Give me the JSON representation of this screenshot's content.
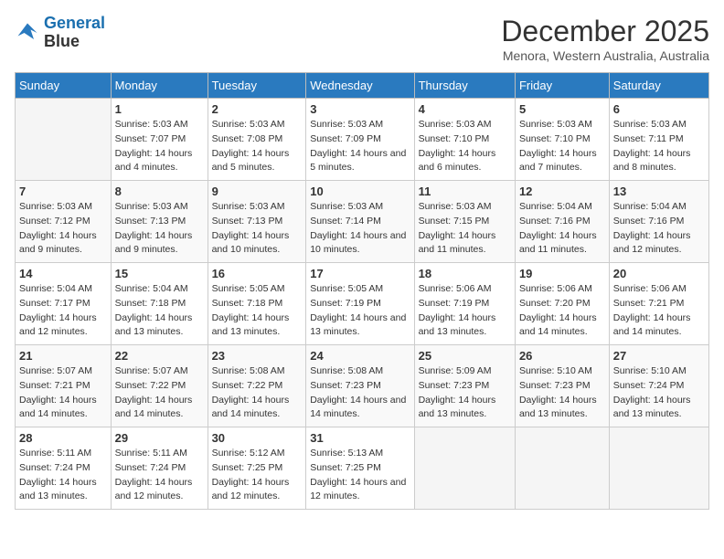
{
  "header": {
    "logo_line1": "General",
    "logo_line2": "Blue",
    "month_title": "December 2025",
    "location": "Menora, Western Australia, Australia"
  },
  "days_of_week": [
    "Sunday",
    "Monday",
    "Tuesday",
    "Wednesday",
    "Thursday",
    "Friday",
    "Saturday"
  ],
  "weeks": [
    [
      {
        "day": "",
        "sunrise": "",
        "sunset": "",
        "daylight": ""
      },
      {
        "day": "1",
        "sunrise": "Sunrise: 5:03 AM",
        "sunset": "Sunset: 7:07 PM",
        "daylight": "Daylight: 14 hours and 4 minutes."
      },
      {
        "day": "2",
        "sunrise": "Sunrise: 5:03 AM",
        "sunset": "Sunset: 7:08 PM",
        "daylight": "Daylight: 14 hours and 5 minutes."
      },
      {
        "day": "3",
        "sunrise": "Sunrise: 5:03 AM",
        "sunset": "Sunset: 7:09 PM",
        "daylight": "Daylight: 14 hours and 5 minutes."
      },
      {
        "day": "4",
        "sunrise": "Sunrise: 5:03 AM",
        "sunset": "Sunset: 7:10 PM",
        "daylight": "Daylight: 14 hours and 6 minutes."
      },
      {
        "day": "5",
        "sunrise": "Sunrise: 5:03 AM",
        "sunset": "Sunset: 7:10 PM",
        "daylight": "Daylight: 14 hours and 7 minutes."
      },
      {
        "day": "6",
        "sunrise": "Sunrise: 5:03 AM",
        "sunset": "Sunset: 7:11 PM",
        "daylight": "Daylight: 14 hours and 8 minutes."
      }
    ],
    [
      {
        "day": "7",
        "sunrise": "Sunrise: 5:03 AM",
        "sunset": "Sunset: 7:12 PM",
        "daylight": "Daylight: 14 hours and 9 minutes."
      },
      {
        "day": "8",
        "sunrise": "Sunrise: 5:03 AM",
        "sunset": "Sunset: 7:13 PM",
        "daylight": "Daylight: 14 hours and 9 minutes."
      },
      {
        "day": "9",
        "sunrise": "Sunrise: 5:03 AM",
        "sunset": "Sunset: 7:13 PM",
        "daylight": "Daylight: 14 hours and 10 minutes."
      },
      {
        "day": "10",
        "sunrise": "Sunrise: 5:03 AM",
        "sunset": "Sunset: 7:14 PM",
        "daylight": "Daylight: 14 hours and 10 minutes."
      },
      {
        "day": "11",
        "sunrise": "Sunrise: 5:03 AM",
        "sunset": "Sunset: 7:15 PM",
        "daylight": "Daylight: 14 hours and 11 minutes."
      },
      {
        "day": "12",
        "sunrise": "Sunrise: 5:04 AM",
        "sunset": "Sunset: 7:16 PM",
        "daylight": "Daylight: 14 hours and 11 minutes."
      },
      {
        "day": "13",
        "sunrise": "Sunrise: 5:04 AM",
        "sunset": "Sunset: 7:16 PM",
        "daylight": "Daylight: 14 hours and 12 minutes."
      }
    ],
    [
      {
        "day": "14",
        "sunrise": "Sunrise: 5:04 AM",
        "sunset": "Sunset: 7:17 PM",
        "daylight": "Daylight: 14 hours and 12 minutes."
      },
      {
        "day": "15",
        "sunrise": "Sunrise: 5:04 AM",
        "sunset": "Sunset: 7:18 PM",
        "daylight": "Daylight: 14 hours and 13 minutes."
      },
      {
        "day": "16",
        "sunrise": "Sunrise: 5:05 AM",
        "sunset": "Sunset: 7:18 PM",
        "daylight": "Daylight: 14 hours and 13 minutes."
      },
      {
        "day": "17",
        "sunrise": "Sunrise: 5:05 AM",
        "sunset": "Sunset: 7:19 PM",
        "daylight": "Daylight: 14 hours and 13 minutes."
      },
      {
        "day": "18",
        "sunrise": "Sunrise: 5:06 AM",
        "sunset": "Sunset: 7:19 PM",
        "daylight": "Daylight: 14 hours and 13 minutes."
      },
      {
        "day": "19",
        "sunrise": "Sunrise: 5:06 AM",
        "sunset": "Sunset: 7:20 PM",
        "daylight": "Daylight: 14 hours and 14 minutes."
      },
      {
        "day": "20",
        "sunrise": "Sunrise: 5:06 AM",
        "sunset": "Sunset: 7:21 PM",
        "daylight": "Daylight: 14 hours and 14 minutes."
      }
    ],
    [
      {
        "day": "21",
        "sunrise": "Sunrise: 5:07 AM",
        "sunset": "Sunset: 7:21 PM",
        "daylight": "Daylight: 14 hours and 14 minutes."
      },
      {
        "day": "22",
        "sunrise": "Sunrise: 5:07 AM",
        "sunset": "Sunset: 7:22 PM",
        "daylight": "Daylight: 14 hours and 14 minutes."
      },
      {
        "day": "23",
        "sunrise": "Sunrise: 5:08 AM",
        "sunset": "Sunset: 7:22 PM",
        "daylight": "Daylight: 14 hours and 14 minutes."
      },
      {
        "day": "24",
        "sunrise": "Sunrise: 5:08 AM",
        "sunset": "Sunset: 7:23 PM",
        "daylight": "Daylight: 14 hours and 14 minutes."
      },
      {
        "day": "25",
        "sunrise": "Sunrise: 5:09 AM",
        "sunset": "Sunset: 7:23 PM",
        "daylight": "Daylight: 14 hours and 13 minutes."
      },
      {
        "day": "26",
        "sunrise": "Sunrise: 5:10 AM",
        "sunset": "Sunset: 7:23 PM",
        "daylight": "Daylight: 14 hours and 13 minutes."
      },
      {
        "day": "27",
        "sunrise": "Sunrise: 5:10 AM",
        "sunset": "Sunset: 7:24 PM",
        "daylight": "Daylight: 14 hours and 13 minutes."
      }
    ],
    [
      {
        "day": "28",
        "sunrise": "Sunrise: 5:11 AM",
        "sunset": "Sunset: 7:24 PM",
        "daylight": "Daylight: 14 hours and 13 minutes."
      },
      {
        "day": "29",
        "sunrise": "Sunrise: 5:11 AM",
        "sunset": "Sunset: 7:24 PM",
        "daylight": "Daylight: 14 hours and 12 minutes."
      },
      {
        "day": "30",
        "sunrise": "Sunrise: 5:12 AM",
        "sunset": "Sunset: 7:25 PM",
        "daylight": "Daylight: 14 hours and 12 minutes."
      },
      {
        "day": "31",
        "sunrise": "Sunrise: 5:13 AM",
        "sunset": "Sunset: 7:25 PM",
        "daylight": "Daylight: 14 hours and 12 minutes."
      },
      {
        "day": "",
        "sunrise": "",
        "sunset": "",
        "daylight": ""
      },
      {
        "day": "",
        "sunrise": "",
        "sunset": "",
        "daylight": ""
      },
      {
        "day": "",
        "sunrise": "",
        "sunset": "",
        "daylight": ""
      }
    ]
  ]
}
